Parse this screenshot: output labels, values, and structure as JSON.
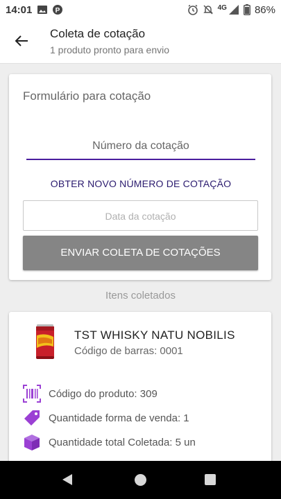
{
  "status_bar": {
    "time": "14:01",
    "network": "4G",
    "battery": "86%",
    "icons": [
      "image-icon",
      "p-app-icon",
      "alarm-icon",
      "notifications-off-icon",
      "signal-icon",
      "battery-icon"
    ]
  },
  "app_bar": {
    "title": "Coleta de cotação",
    "subtitle": "1 produto pronto para envio",
    "back_icon": "arrow-back-icon"
  },
  "form": {
    "heading": "Formulário para cotação",
    "quote_number_placeholder": "Número da cotação",
    "new_number_label": "OBTER NOVO NÚMERO DE COTAÇÃO",
    "date_placeholder": "Data da cotação",
    "send_label": "ENVIAR COLETA DE COTAÇÕES"
  },
  "items_section": {
    "label": "Itens coletados"
  },
  "items": [
    {
      "name": "TST WHISKY NATU NOBILIS",
      "barcode": "Código de barras: 0001",
      "product_code": "Código do produto: 309",
      "sale_quantity": "Quantidade forma de venda: 1",
      "total_quantity": "Quantidade total Coletada: 5 un"
    }
  ],
  "colors": {
    "accent": "#4a1d9e",
    "icon_purple": "#9b40d4",
    "button_gray": "#858585"
  }
}
